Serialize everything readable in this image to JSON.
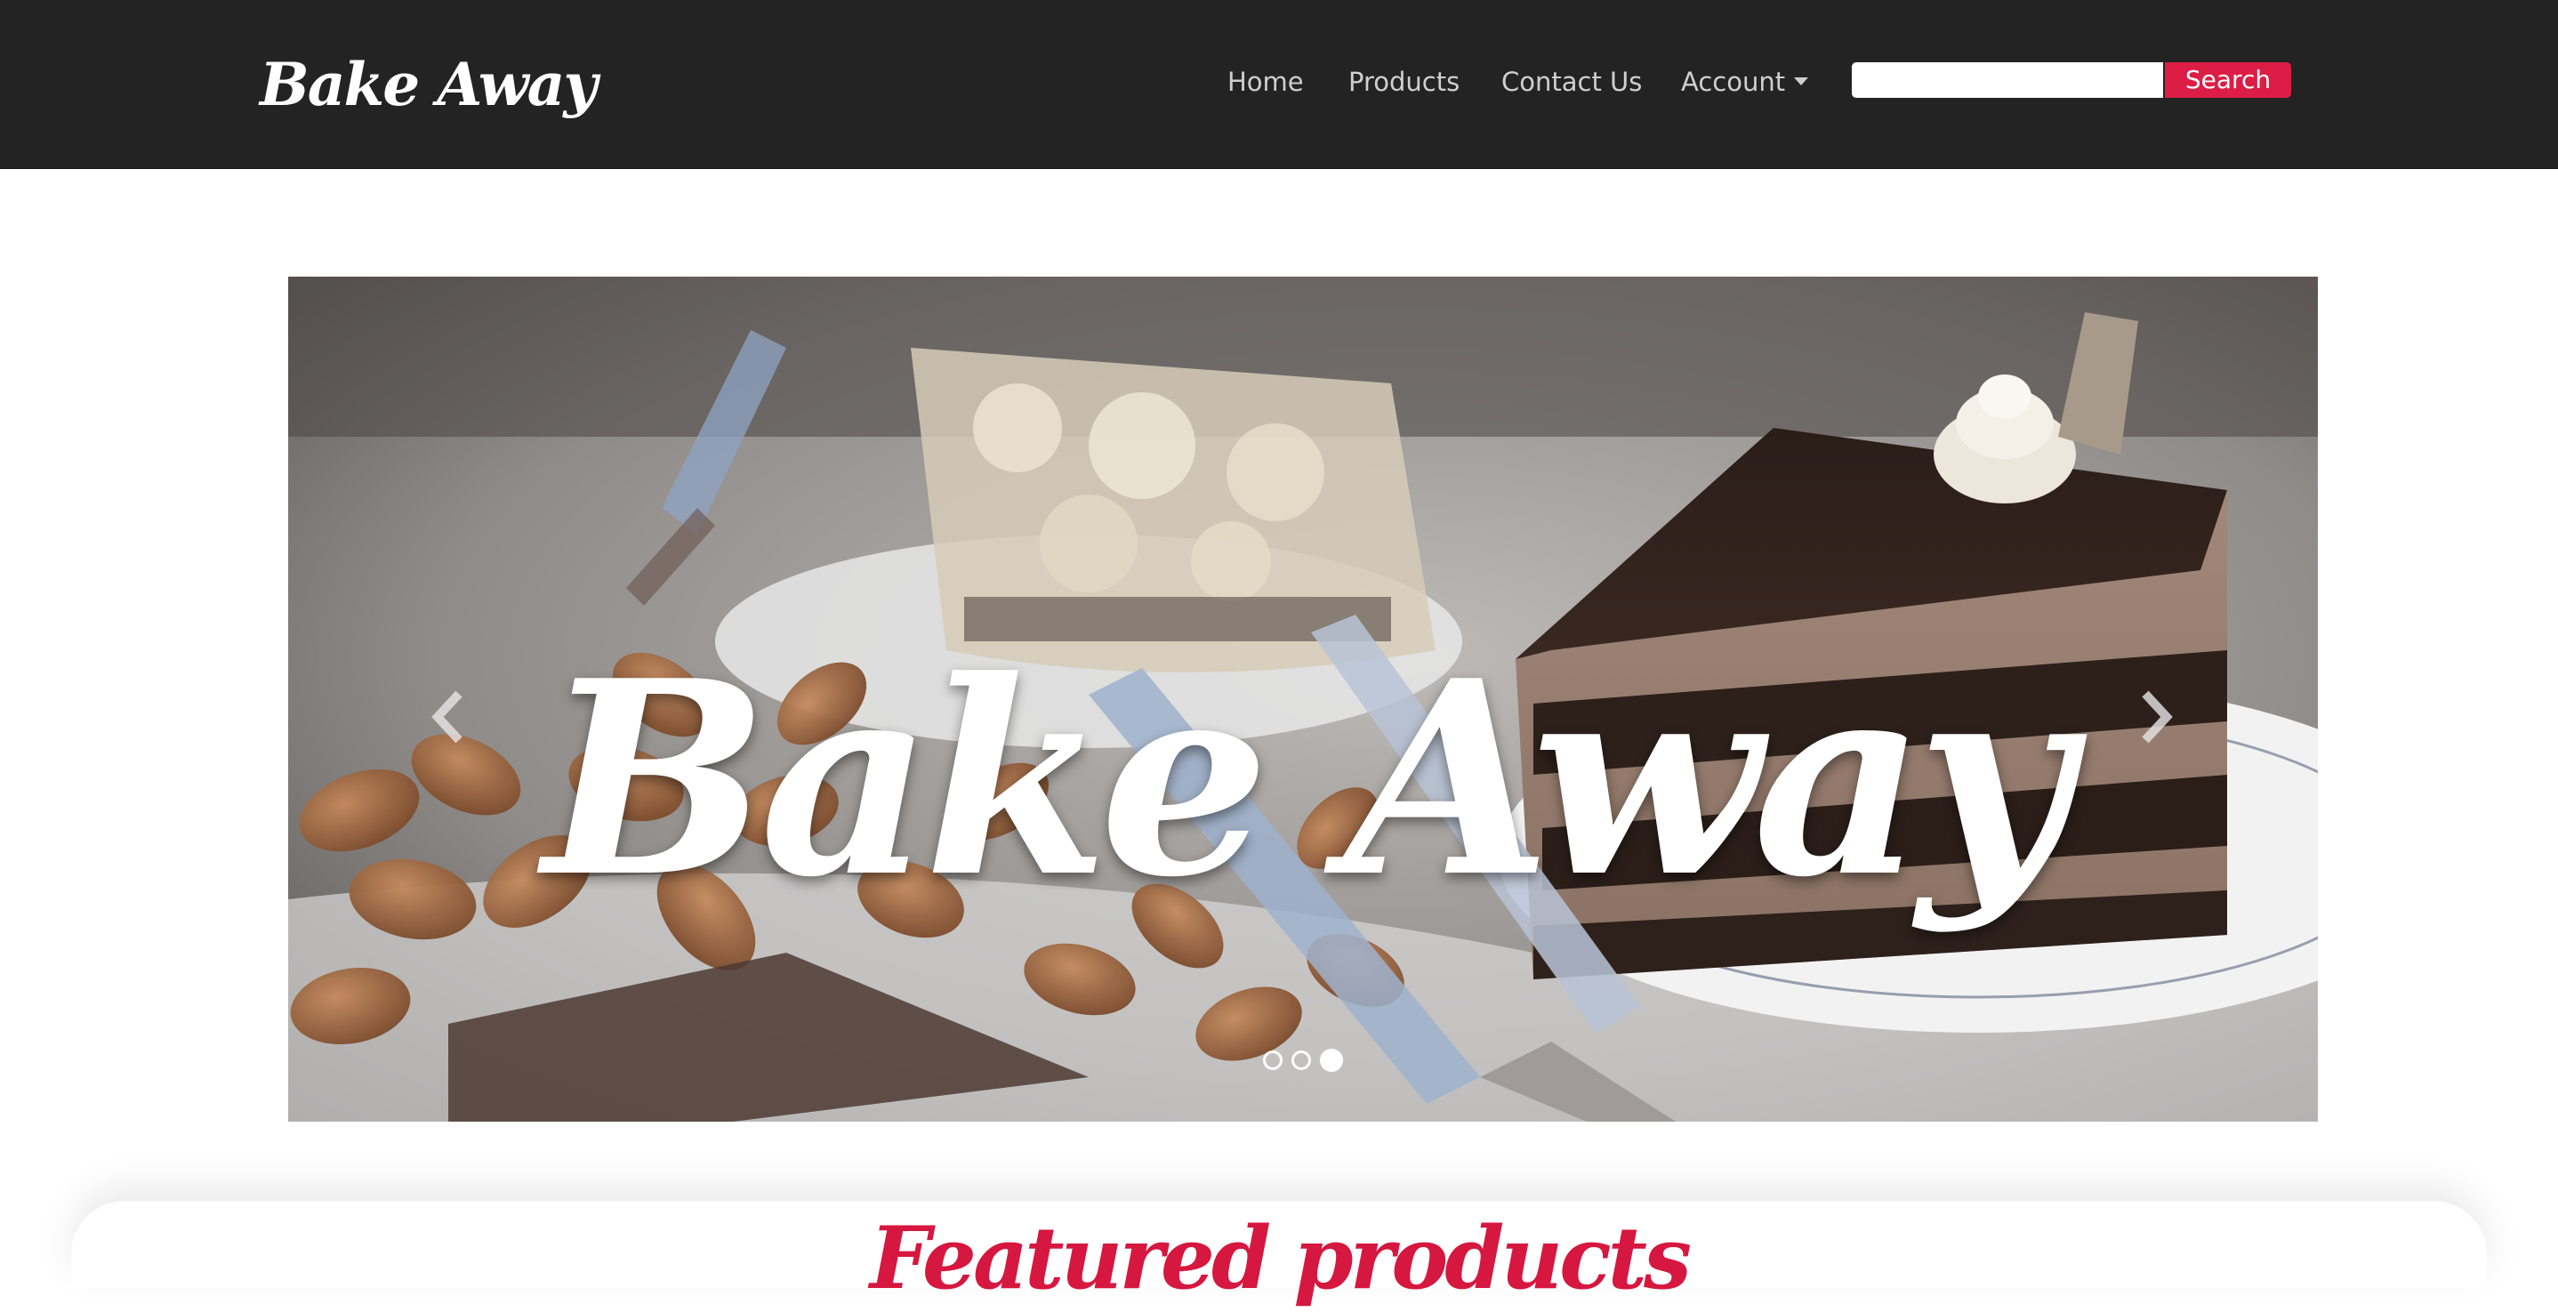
{
  "navbar": {
    "brand": "Bake Away",
    "links": [
      {
        "label": "Home"
      },
      {
        "label": "Products"
      },
      {
        "label": "Contact Us"
      },
      {
        "label": "Account",
        "has_dropdown": true
      }
    ],
    "search": {
      "value": "",
      "placeholder": "",
      "button_label": "Search"
    }
  },
  "carousel": {
    "title": "Bake Away",
    "slide_count": 3,
    "active_slide": 3,
    "prev_icon": "chevron-left-icon",
    "next_icon": "chevron-right-icon"
  },
  "featured": {
    "title": "Featured products"
  },
  "colors": {
    "navbar_bg": "#232323",
    "accent": "#dc1d45",
    "nav_text": "#cfcfcf"
  }
}
